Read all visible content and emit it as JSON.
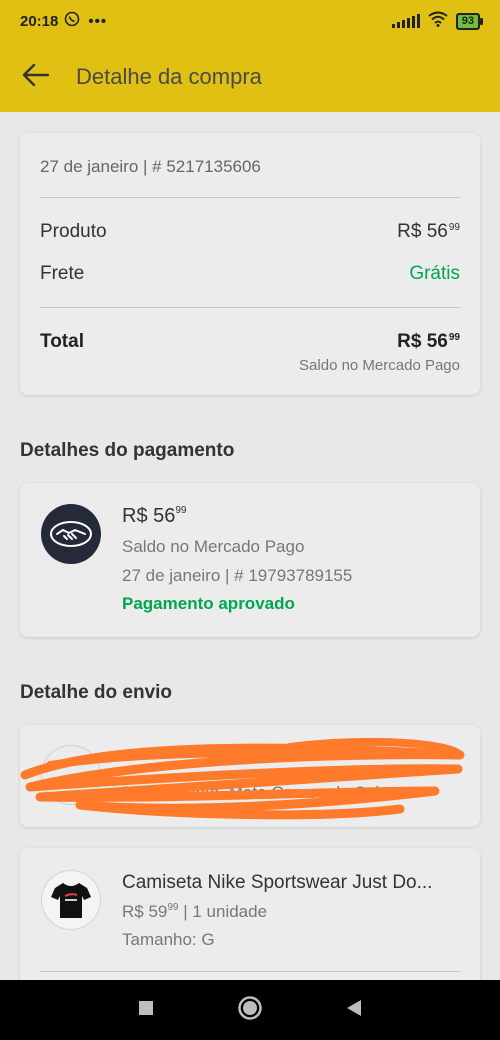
{
  "status_bar": {
    "time": "20:18",
    "dots": "•••",
    "battery": "93"
  },
  "app_bar": {
    "title": "Detalhe da compra"
  },
  "summary": {
    "meta": "27 de janeiro  |  # 5217135606",
    "product_label": "Produto",
    "product_price_main": "R$ 56",
    "product_price_cents": "99",
    "shipping_label": "Frete",
    "shipping_value": "Grátis",
    "total_label": "Total",
    "total_price_main": "R$ 56",
    "total_price_cents": "99",
    "pay_method": "Saldo no Mercado Pago"
  },
  "payment": {
    "section_title": "Detalhes do pagamento",
    "amount_main": "R$ 56",
    "amount_cents": "99",
    "method": "Saldo no Mercado Pago",
    "meta": "27 de janeiro  |  # 19793789155",
    "status": "Pagamento aprovado"
  },
  "shipping": {
    "section_title": "Detalhe do envio",
    "line1": "",
    "line2": "Rio Brilhante, Mato Grosso do Sul"
  },
  "product": {
    "name": "Camiseta Nike Sportswear Just Do...",
    "price_main": "R$ 59",
    "price_cents": "99",
    "quantity": " | 1 unidade",
    "size": "Tamanho: G"
  },
  "colors": {
    "brand_yellow": "#e0c012",
    "success_green": "#00a650",
    "redaction_orange": "#ff7a2a"
  }
}
